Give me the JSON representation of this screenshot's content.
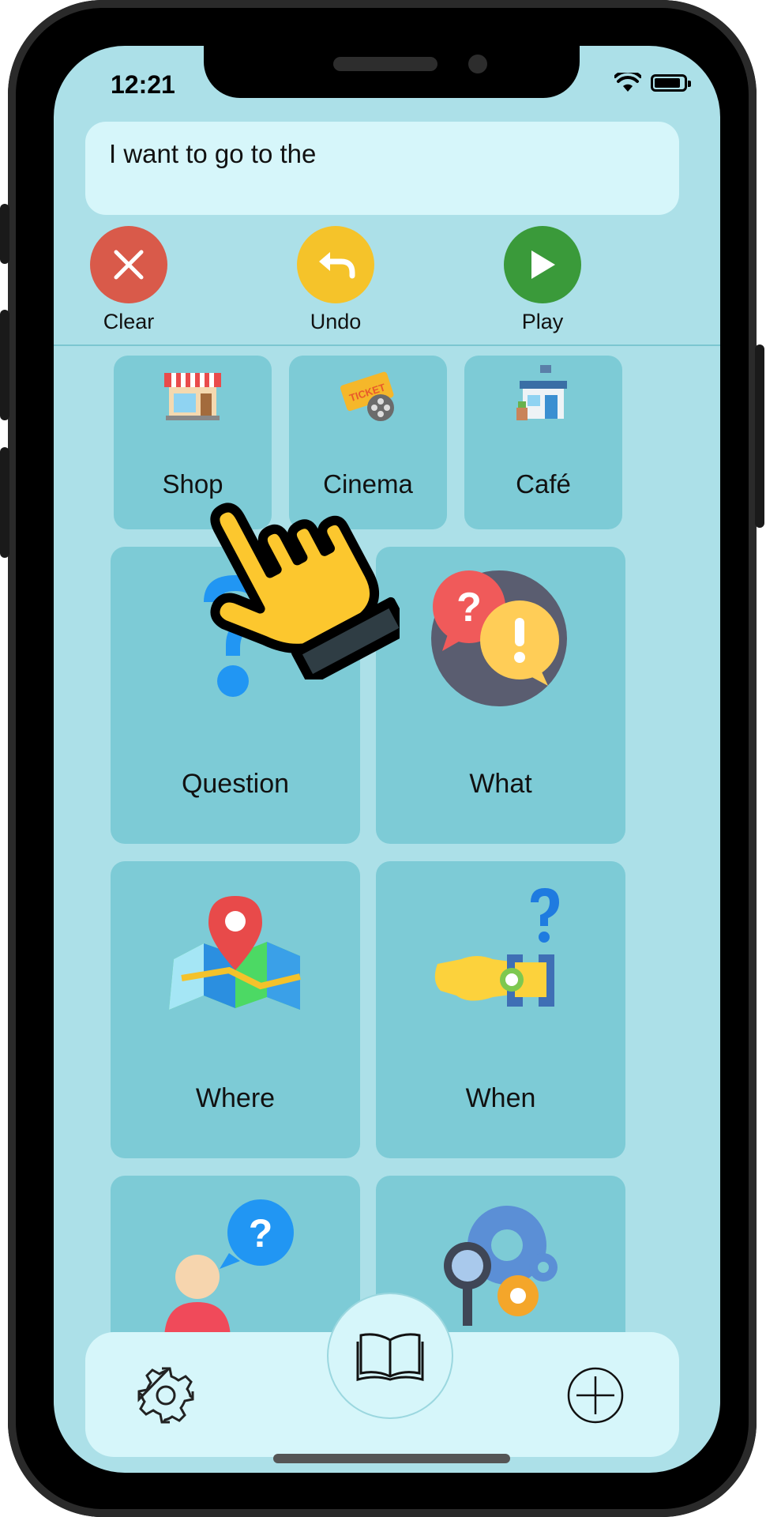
{
  "status_bar": {
    "time": "12:21",
    "battery_level": 0.9
  },
  "sentence": {
    "text": "I want to go to the"
  },
  "actions": {
    "clear": {
      "label": "Clear",
      "color": "#d95a4a",
      "icon": "close-icon"
    },
    "undo": {
      "label": "Undo",
      "color": "#f5c32a",
      "icon": "undo-arrow-icon"
    },
    "play": {
      "label": "Play",
      "color": "#3a9a3a",
      "icon": "play-icon"
    }
  },
  "grid": {
    "row1": [
      {
        "label": "Shop",
        "icon": "shop-icon"
      },
      {
        "label": "Cinema",
        "icon": "cinema-ticket-icon"
      },
      {
        "label": "Café",
        "icon": "cafe-icon"
      }
    ],
    "row2": [
      {
        "label": "Question",
        "icon": "question-mark-icon"
      },
      {
        "label": "What",
        "icon": "question-exclamation-icon"
      }
    ],
    "row3": [
      {
        "label": "Where",
        "icon": "map-pin-icon"
      },
      {
        "label": "When",
        "icon": "wristwatch-question-icon"
      }
    ],
    "row4": [
      {
        "label": "",
        "icon": "person-question-icon"
      },
      {
        "label": "",
        "icon": "gears-magnifier-icon"
      }
    ]
  },
  "bottom_bar": {
    "settings_icon": "gear-icon",
    "library_icon": "open-book-icon",
    "add_icon": "plus-circle-icon"
  },
  "colors": {
    "screen_bg": "#ace0e8",
    "tile_bg": "#7dcbd6",
    "panel_bg": "#d6f6fa"
  }
}
